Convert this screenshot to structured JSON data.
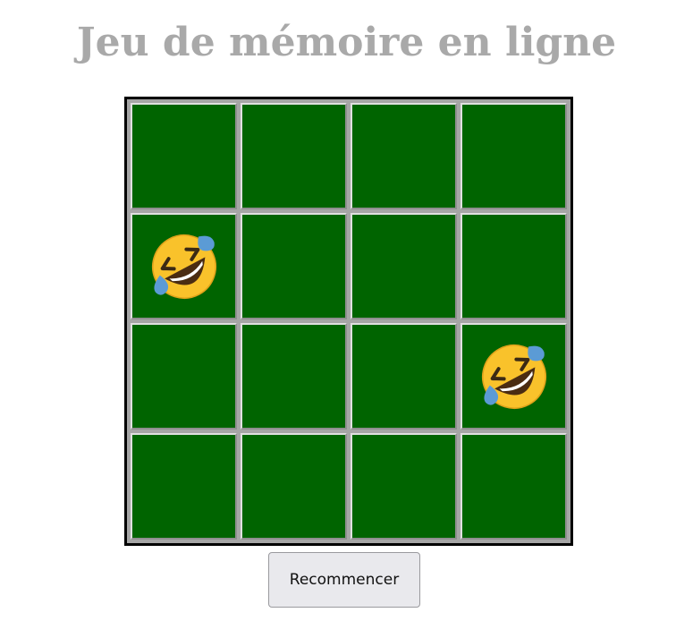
{
  "title": "Jeu de mémoire en ligne",
  "board": {
    "rows": 4,
    "cols": 4,
    "card_back_color": "#006400",
    "revealed": [
      {
        "row": 1,
        "col": 0,
        "symbol": "rolling-on-floor-laughing-emoji"
      },
      {
        "row": 2,
        "col": 3,
        "symbol": "rolling-on-floor-laughing-emoji"
      }
    ]
  },
  "restart_button": {
    "label": "Recommencer"
  }
}
